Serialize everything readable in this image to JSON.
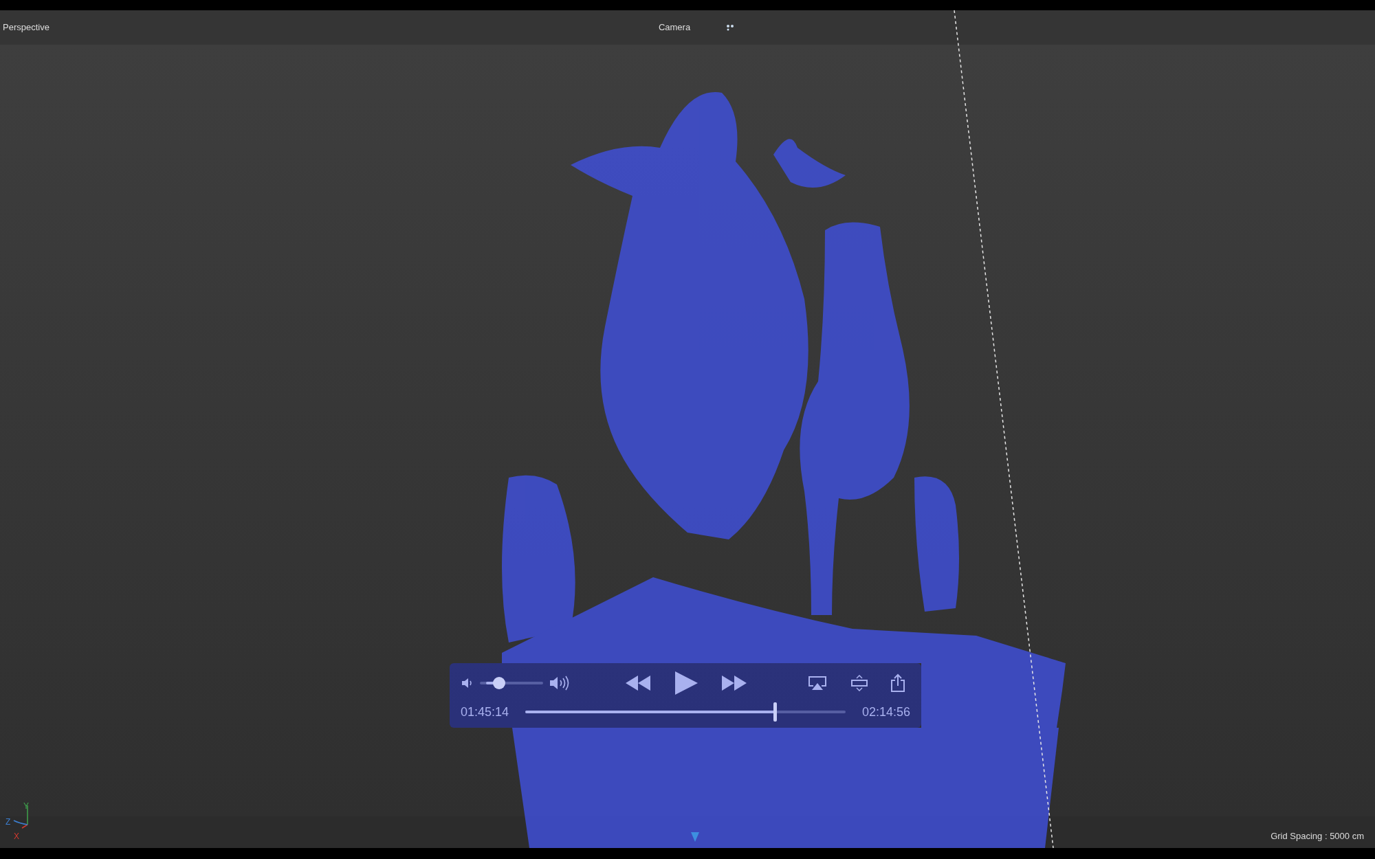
{
  "viewport": {
    "view_label": "Perspective",
    "camera_label": "Camera",
    "grid_spacing": "Grid Spacing : 5000 cm",
    "axes": [
      {
        "label": "Y",
        "color": "#3fa34d"
      },
      {
        "label": "Z",
        "color": "#3c7fd0"
      },
      {
        "label": "X",
        "color": "#d0392f"
      }
    ]
  },
  "player": {
    "volume": {
      "level": 0.25
    },
    "elapsed": "01:45:14",
    "duration": "02:14:56",
    "progress": {
      "level": 0.78
    }
  }
}
